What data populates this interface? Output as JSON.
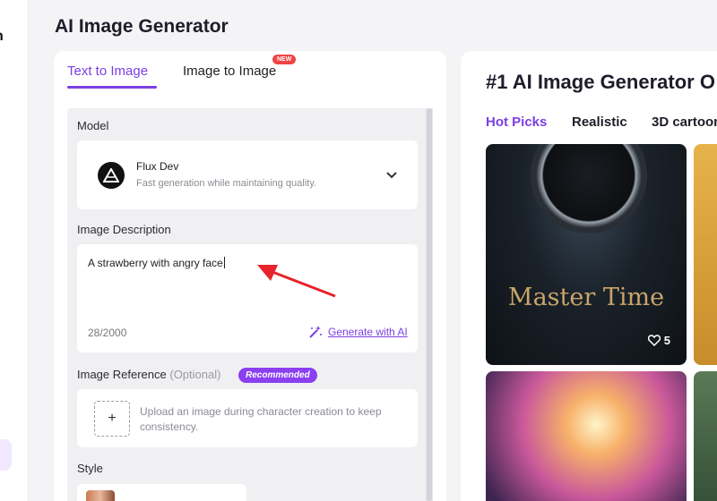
{
  "page": {
    "title": "AI Image Generator"
  },
  "sidebar": {
    "fragment_text": "n"
  },
  "tabs": [
    {
      "label": "Text to Image",
      "active": true
    },
    {
      "label": "Image to Image",
      "badge": "NEW"
    }
  ],
  "model": {
    "section_label": "Model",
    "name": "Flux Dev",
    "description": "Fast generation while maintaining quality."
  },
  "description": {
    "section_label": "Image Description",
    "value": "A strawberry with angry face",
    "counter": "28/2000",
    "generate_ai_label": "Generate with AI"
  },
  "reference": {
    "section_label": "Image Reference",
    "optional_label": "(Optional)",
    "badge": "Recommended",
    "upload_symbol": "+",
    "upload_text": "Upload an image during character creation to keep consistency."
  },
  "style": {
    "section_label": "Style"
  },
  "gallery": {
    "title": "#1 AI Image Generator O",
    "categories": [
      {
        "label": "Hot Picks",
        "active": true
      },
      {
        "label": "Realistic"
      },
      {
        "label": "3D cartoon"
      }
    ],
    "cards": [
      {
        "overlay_text": "Master Time",
        "likes": "5"
      }
    ]
  },
  "colors": {
    "accent": "#7b3fe4",
    "badge_new": "#ef4444",
    "annotation_arrow": "#e8232a"
  }
}
